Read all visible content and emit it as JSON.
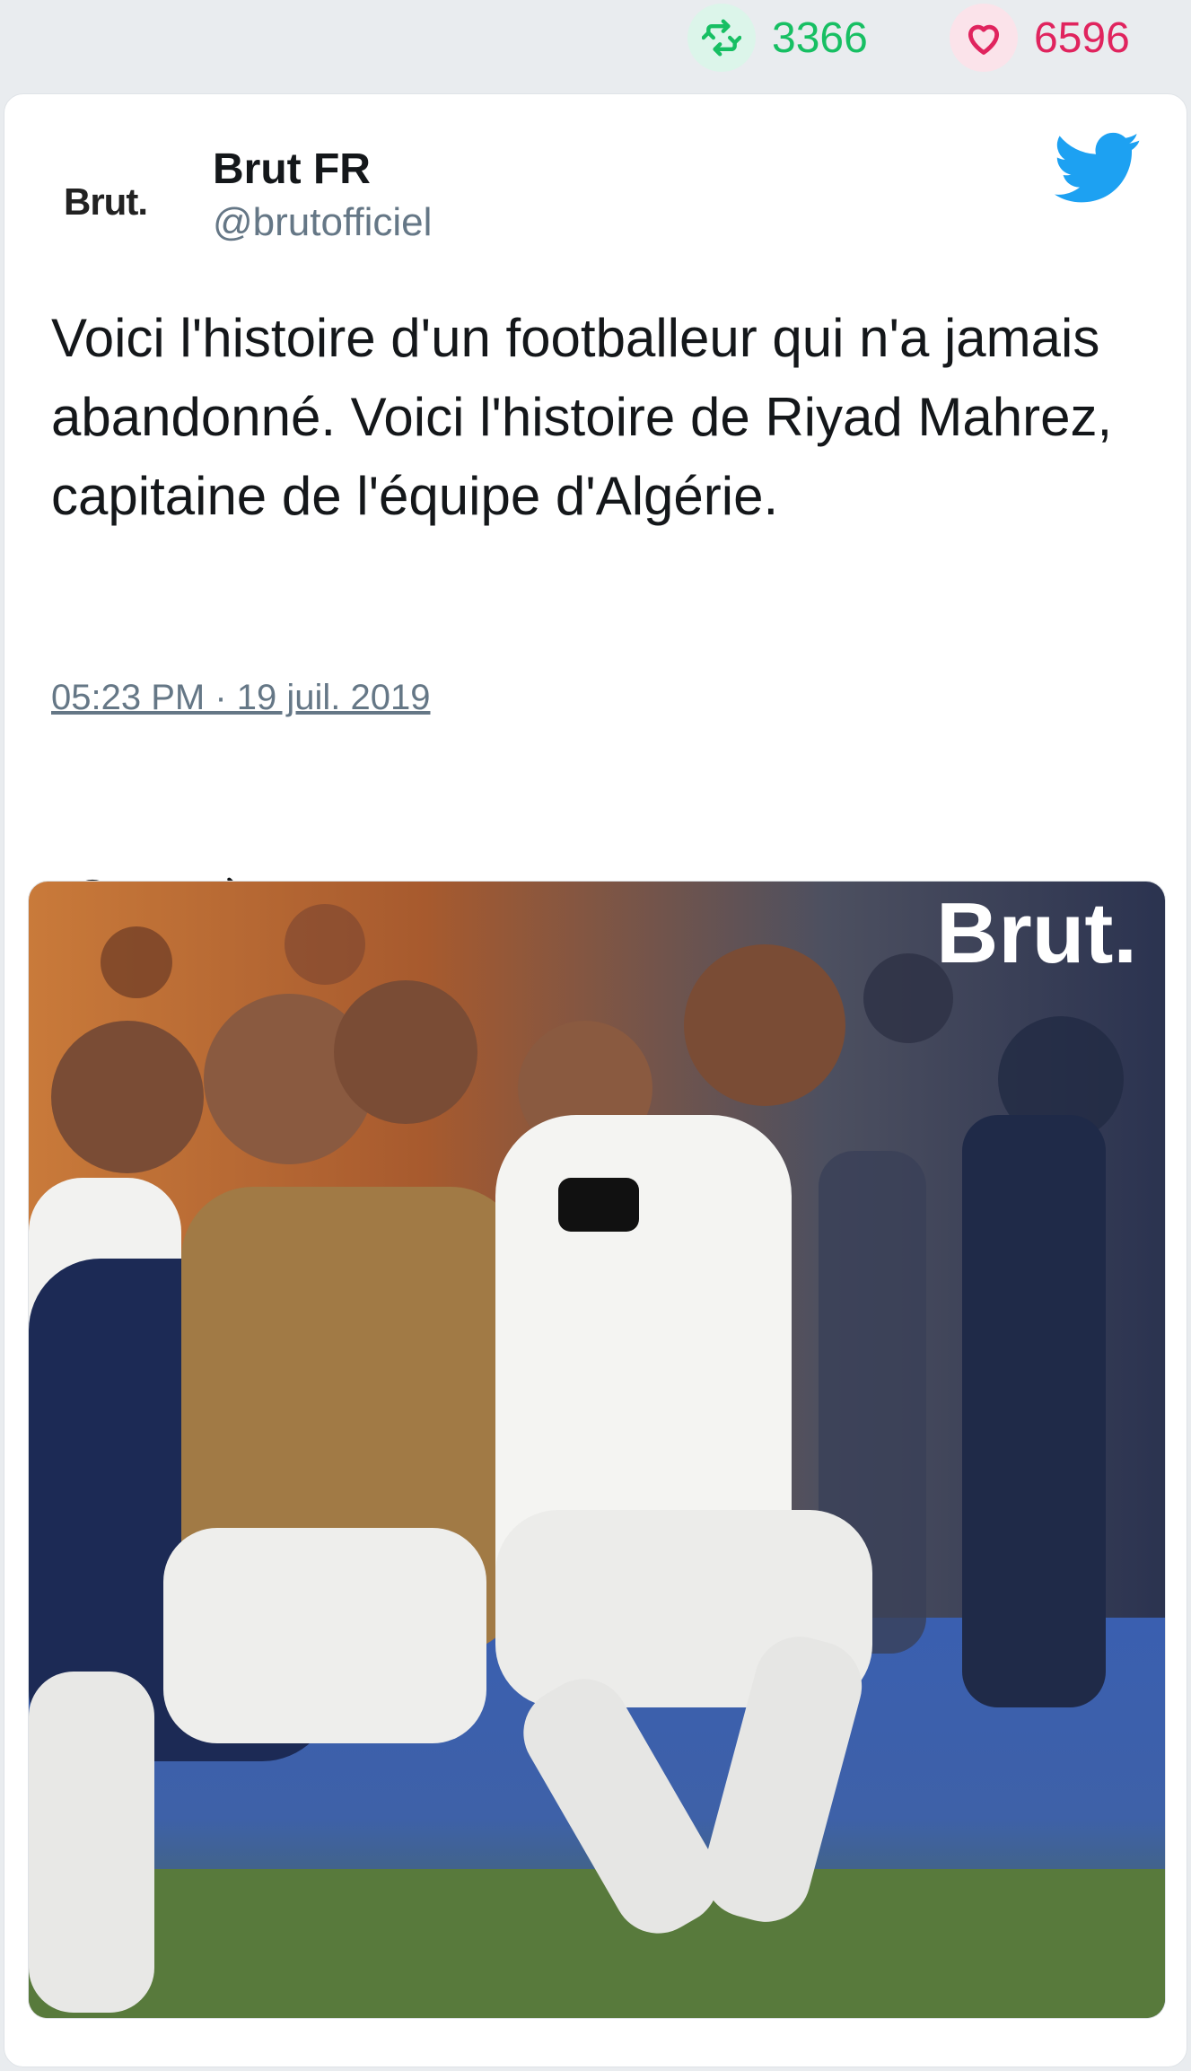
{
  "stats": {
    "retweets": "3366",
    "likes": "6596",
    "retweet_icon": "retweet-icon",
    "like_icon": "heart-icon",
    "retweet_color": "#17bf63",
    "like_color": "#e0245e"
  },
  "tweet": {
    "avatar_logo_text": "Brut.",
    "name": "Brut FR",
    "handle": "@brutofficiel",
    "text": "Voici l'histoire d'un footballeur qui n'a jamais abandonné. Voici l'histoire de Riyad Mahrez, capitaine de l'équipe d'Algérie.",
    "timestamp": "05:23 PM · 19 juil. 2019",
    "brand_icon": "twitter-bird-icon",
    "brand_color": "#1da1f2"
  },
  "actions": {
    "reply_icon": "reply-icon",
    "retweet_icon": "retweet-icon",
    "like_icon": "heart-icon"
  },
  "media": {
    "watermark": "Brut.",
    "subject": "football-celebration-photo"
  }
}
